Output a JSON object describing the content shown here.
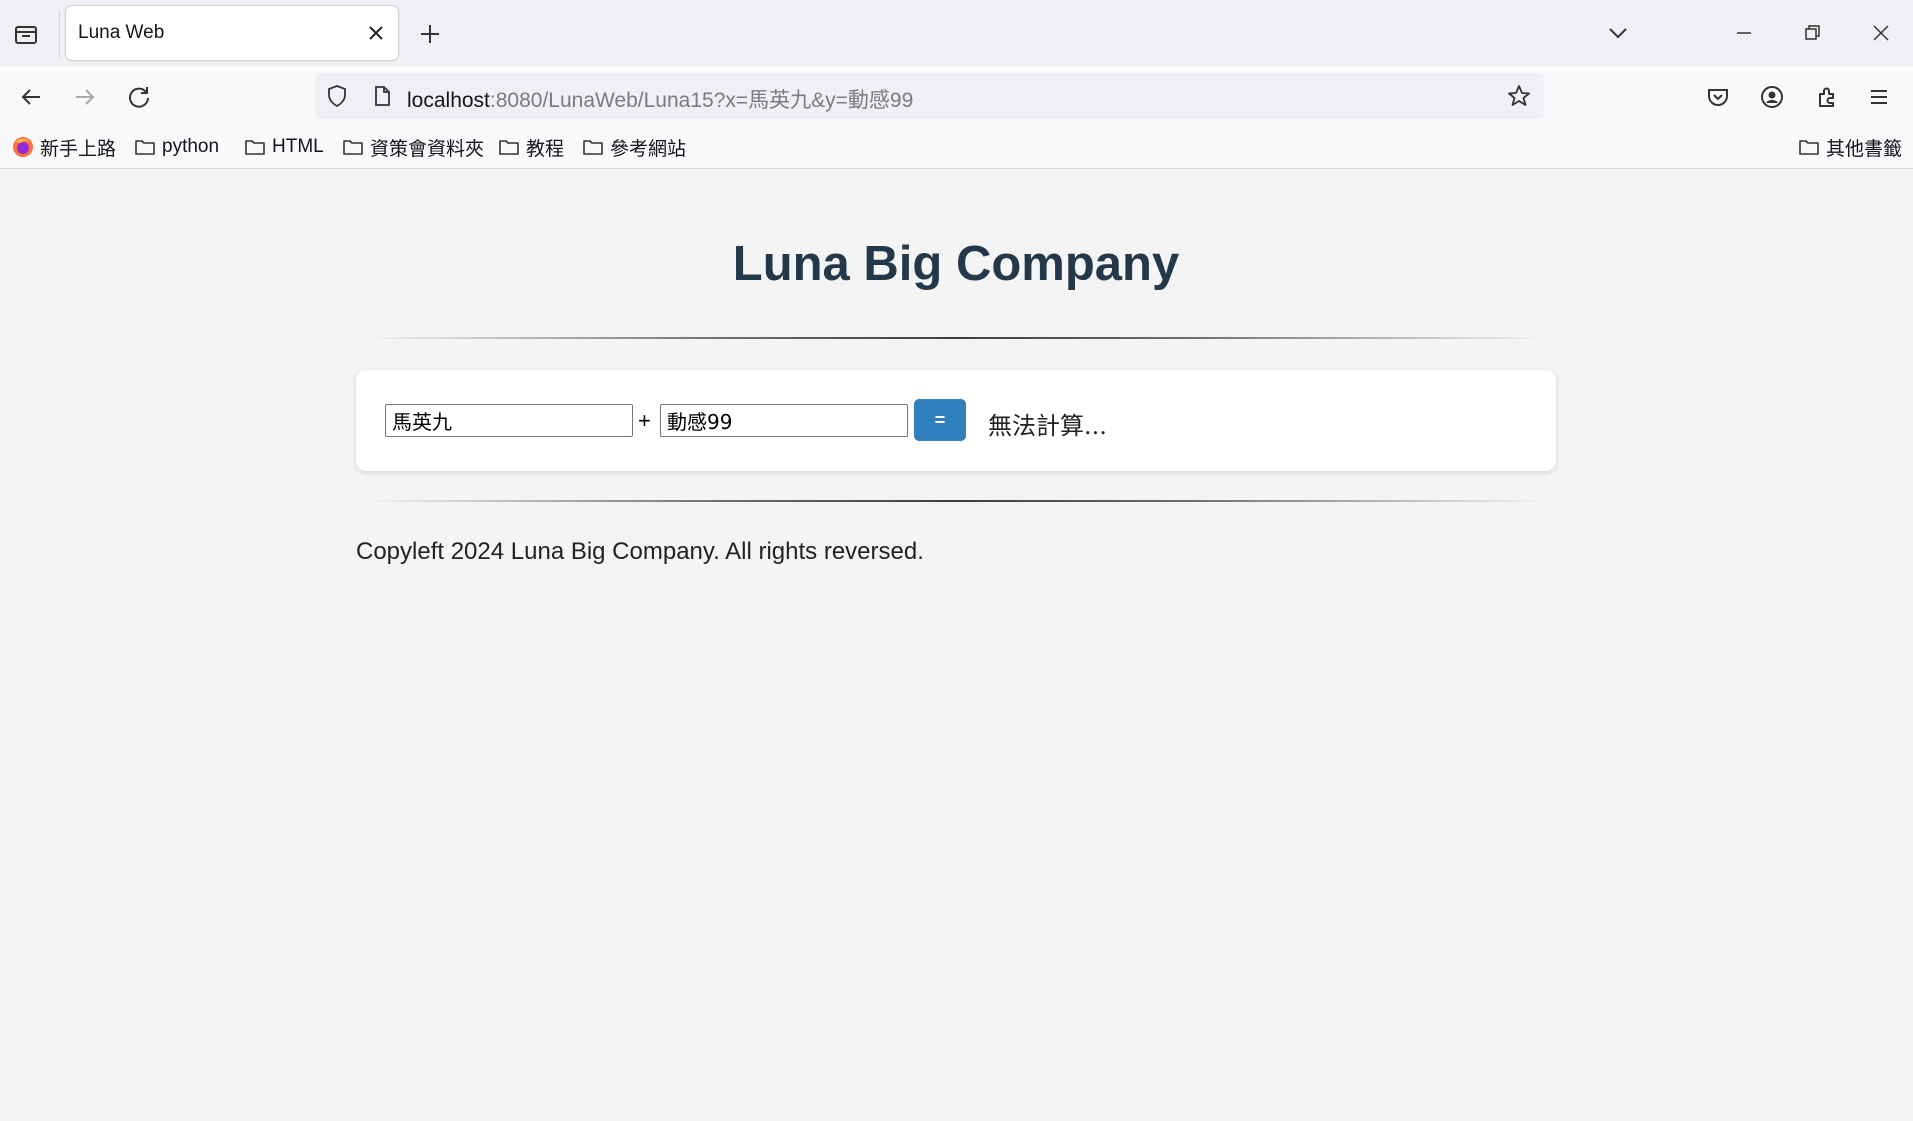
{
  "browser": {
    "tab_title": "Luna Web",
    "url_host": "localhost",
    "url_rest": ":8080/LunaWeb/Luna15?x=馬英九&y=動感99",
    "bookmarks": [
      {
        "label": "新手上路",
        "icon": "firefox-icon"
      },
      {
        "label": "python",
        "icon": "folder-icon"
      },
      {
        "label": "HTML",
        "icon": "folder-icon"
      },
      {
        "label": "資策會資料夾",
        "icon": "folder-icon"
      },
      {
        "label": "教程",
        "icon": "folder-icon"
      },
      {
        "label": "參考網站",
        "icon": "folder-icon"
      }
    ],
    "other_bookmarks": "其他書籤"
  },
  "page": {
    "title": "Luna Big Company",
    "form": {
      "x_value": "馬英九",
      "plus": "+",
      "y_value": "動感99",
      "equals_label": "=",
      "result": "無法計算..."
    },
    "footer": "Copyleft 2024 Luna Big Company. All rights reversed."
  },
  "colors": {
    "title": "#243849",
    "button": "#2f80bd",
    "page_bg": "#f4f4f4"
  }
}
